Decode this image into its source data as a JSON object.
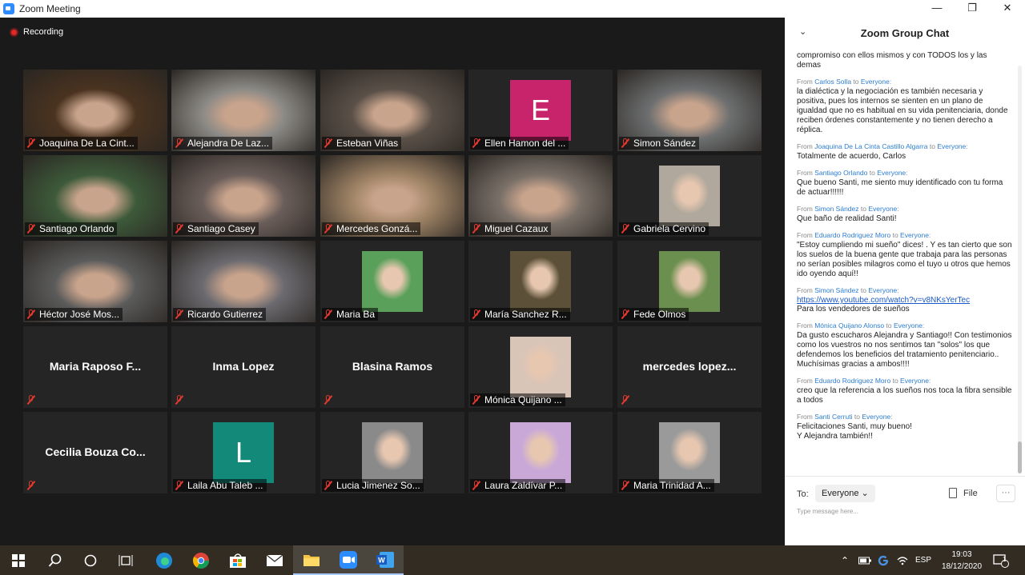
{
  "window": {
    "title": "Zoom Meeting"
  },
  "window_controls": {
    "minimize": "—",
    "restore": "❐",
    "close": "✕"
  },
  "recording": {
    "label": "Recording"
  },
  "participants": [
    {
      "name": "Joaquina De La Cint...",
      "kind": "video",
      "bg": "#4a3320"
    },
    {
      "name": "Alejandra De Laz...",
      "kind": "video",
      "bg": "#8c8a86"
    },
    {
      "name": "Esteban Viñas",
      "kind": "video",
      "bg": "#5a5048"
    },
    {
      "name": "Ellen Hamon del ...",
      "kind": "initial",
      "initial": "E",
      "color": "#c8246b"
    },
    {
      "name": "Simon Sández",
      "kind": "video",
      "bg": "#6d6f70"
    },
    {
      "name": "Santiago Orlando",
      "kind": "video",
      "bg": "#3d5a3a"
    },
    {
      "name": "Santiago Casey",
      "kind": "video",
      "bg": "#6b5e5a",
      "active": true
    },
    {
      "name": "Mercedes Gonzá...",
      "kind": "video",
      "bg": "#a08466"
    },
    {
      "name": "Miguel Cazaux",
      "kind": "video",
      "bg": "#7a7068"
    },
    {
      "name": "Gabriela Cervino",
      "kind": "photo",
      "bg": "#b0a89c"
    },
    {
      "name": "Héctor José Mos...",
      "kind": "video",
      "bg": "#5b5b5b"
    },
    {
      "name": "Ricardo Gutierrez",
      "kind": "video",
      "bg": "#6c6a6f"
    },
    {
      "name": "Maria Ba",
      "kind": "photo",
      "bg": "#5aa05a"
    },
    {
      "name": "María Sanchez R...",
      "kind": "photo",
      "bg": "#5c5138"
    },
    {
      "name": "Fede Olmos",
      "kind": "photo",
      "bg": "#6b8f4e"
    },
    {
      "name": "",
      "kind": "name",
      "bigname": "Maria  Raposo  F..."
    },
    {
      "name": "",
      "kind": "name",
      "bigname": "Inma Lopez"
    },
    {
      "name": "",
      "kind": "name",
      "bigname": "Blasina Ramos"
    },
    {
      "name": "Mónica Quijano ...",
      "kind": "photo",
      "bg": "#d9c4b8"
    },
    {
      "name": "",
      "kind": "name",
      "bigname": "mercedes  lopez..."
    },
    {
      "name": "",
      "kind": "name",
      "bigname": "Cecilia  Bouza  Co..."
    },
    {
      "name": "Laila Abu Taleb ...",
      "kind": "initial",
      "initial": "L",
      "color": "#13897a"
    },
    {
      "name": "Lucia Jimenez So...",
      "kind": "photo",
      "bg": "#8a8a8a"
    },
    {
      "name": "Laura Zaldívar P...",
      "kind": "photo",
      "bg": "#c9a8d8"
    },
    {
      "name": "Maria Trinidad A...",
      "kind": "photo",
      "bg": "#9a9a9a"
    }
  ],
  "chat": {
    "title": "Zoom Group Chat",
    "messages": [
      {
        "from": "",
        "to": "",
        "text": "compromiso con ellos mismos y con TODOS los y las demas"
      },
      {
        "from": "Carlos Solla",
        "to": "Everyone",
        "text": "la dialéctica y la negociación es también necesaria y positiva, pues los internos se sienten en un plano de igualdad que no es habitual en su vida penitenciaria, donde reciben órdenes constantemente y no tienen derecho a réplica."
      },
      {
        "from": "Joaquina De La Cinta Castillo Algarra",
        "to": "Everyone",
        "text": "Totalmente de acuerdo, Carlos"
      },
      {
        "from": "Santiago Orlando",
        "to": "Everyone",
        "text": "Que bueno Santi, me siento muy identificado con tu forma de actuar!!!!!!"
      },
      {
        "from": "Simon Sández",
        "to": "Everyone",
        "text": "Que baño de realidad Santi!"
      },
      {
        "from": "Eduardo Rodriguez Moro",
        "to": "Everyone",
        "text": "\"Estoy cumpliendo mi sueño\" dices! . Y es tan cierto que son los suelos de la buena gente que trabaja para las personas no serían posibles milagros como el tuyo u otros que hemos ido oyendo aquí!!"
      },
      {
        "from": "Simon Sández",
        "to": "Everyone",
        "link": "https://www.youtube.com/watch?v=v8NKsYerTec",
        "text": "Para los vendedores de sueños"
      },
      {
        "from": "Mónica Quijano Alonso",
        "to": "Everyone",
        "text": "Da gusto escucharos Alejandra y Santiago!! Con testimonios como los vuestros no nos sentimos tan \"solos\" los que defendemos los beneficios del tratamiento penitenciario.. Muchísimas gracias a ambos!!!!"
      },
      {
        "from": "Eduardo Rodriguez Moro",
        "to": "Everyone",
        "text": "creo que la referencia a los sueños nos toca la fibra sensible a todos"
      },
      {
        "from": "Santi Cerruti",
        "to": "Everyone",
        "text": "Felicitaciones Santi, muy bueno!\nY Alejandra también!!"
      }
    ],
    "from_prefix": "From",
    "to_word": "to",
    "to_label": "To:",
    "to_value": "Everyone ⌄",
    "file_label": "File",
    "more_label": "···",
    "input_placeholder": "Type message here..."
  },
  "taskbar": {
    "language": "ESP",
    "time": "19:03",
    "date": "18/12/2020",
    "notification_count": "1"
  },
  "colors": {
    "accent": "#2d8cff",
    "mute": "#e3392f",
    "active_speaker": "#d7e566"
  }
}
